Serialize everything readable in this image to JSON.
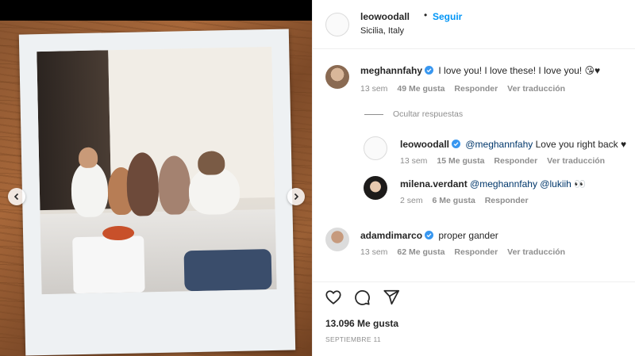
{
  "post": {
    "username": "leowoodall",
    "separator": "•",
    "follow_label": "Seguir",
    "location": "Sicilia, Italy",
    "media_prev_icon": "chevron-left-icon",
    "media_next_icon": "chevron-right-icon"
  },
  "comments": [
    {
      "username": "meghannfahy",
      "verified": true,
      "text": "I love you! I love these! I love you! 😘♥",
      "time": "13 sem",
      "likes": "49 Me gusta",
      "reply_label": "Responder",
      "translate_label": "Ver traducción"
    },
    {
      "username": "adamdimarco",
      "verified": true,
      "text": "proper gander",
      "time": "13 sem",
      "likes": "62 Me gusta",
      "reply_label": "Responder",
      "translate_label": "Ver traducción"
    }
  ],
  "hide_replies_label": "Ocultar respuestas",
  "replies": [
    {
      "username": "leowoodall",
      "verified": true,
      "mention": "@meghannfahy",
      "text": "Love you right back ♥",
      "time": "13 sem",
      "likes": "15 Me gusta",
      "reply_label": "Responder",
      "translate_label": "Ver traducción"
    },
    {
      "username": "milena.verdant",
      "verified": false,
      "mention": "@meghannfahy",
      "mention2": "@lukiih",
      "text": "👀",
      "time": "2 sem",
      "likes": "6 Me gusta",
      "reply_label": "Responder"
    }
  ],
  "actions": {
    "like_icon": "heart-icon",
    "comment_icon": "comment-icon",
    "share_icon": "paper-plane-icon",
    "likes_count": "13.096 Me gusta",
    "date": "SEPTIEMBRE 11"
  },
  "colors": {
    "accent": "#0095f6",
    "verified": "#3897f0",
    "meta": "#8e8e8e",
    "text": "#262626",
    "mention": "#00376b"
  }
}
